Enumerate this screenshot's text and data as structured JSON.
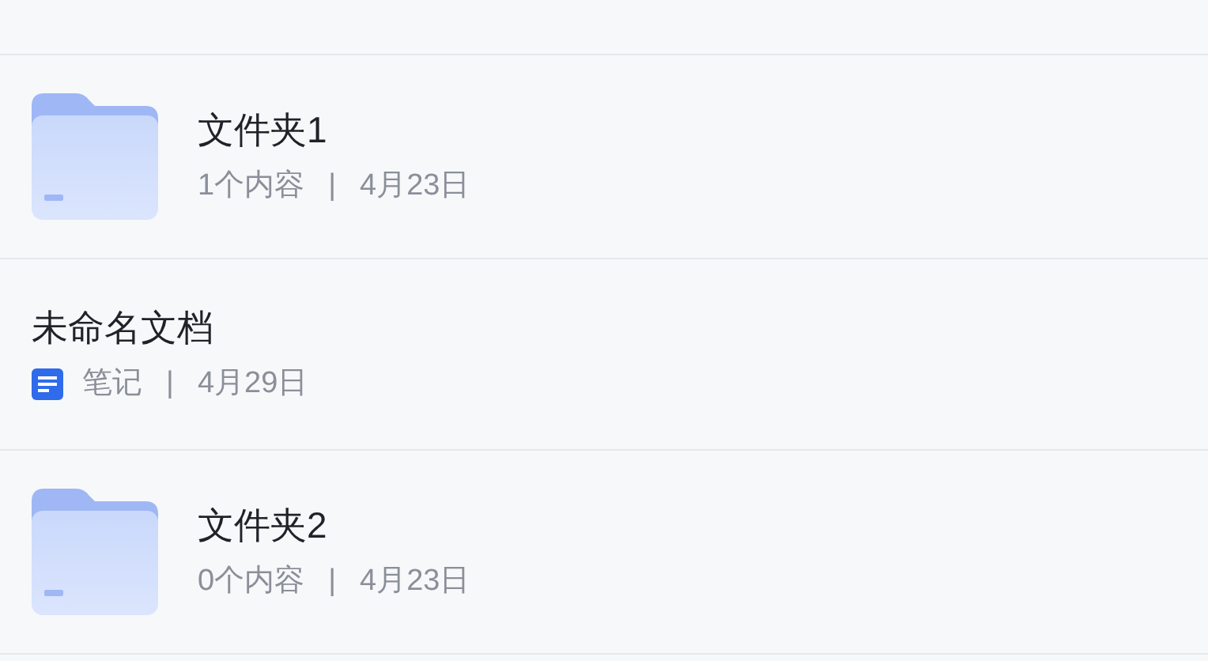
{
  "items": [
    {
      "kind": "folder",
      "name": "文件夹1",
      "meta": "1个内容",
      "separator": "|",
      "date": "4月23日"
    },
    {
      "kind": "note",
      "name": "未命名文档",
      "meta": "笔记",
      "separator": "|",
      "date": "4月29日"
    },
    {
      "kind": "folder",
      "name": "文件夹2",
      "meta": "0个内容",
      "separator": "|",
      "date": "4月23日"
    }
  ]
}
